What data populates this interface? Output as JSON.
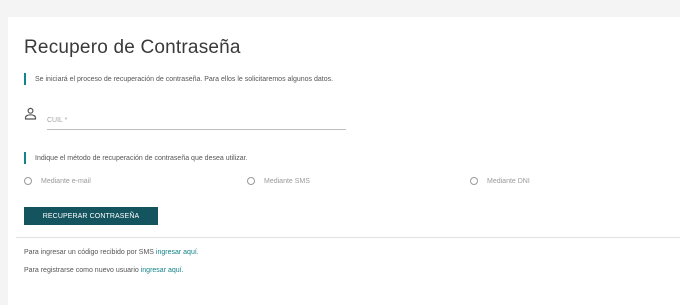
{
  "form": {
    "title": "Recupero de Contraseña",
    "intro": "Se iniciará el proceso de recuperación de contraseña. Para ellos le solicitaremos algunos datos.",
    "cuil_placeholder": "CUIL *",
    "cuil_value": "",
    "method_prompt": "Indique el método de recuperación de contraseña que desea utilizar.",
    "options": [
      {
        "label": "Mediante e-mail"
      },
      {
        "label": "Mediante SMS"
      },
      {
        "label": "Mediante DNI"
      }
    ],
    "submit_label": "RECUPERAR CONTRASEÑA"
  },
  "footer": {
    "sms_text": "Para ingresar un código recibido por SMS",
    "sms_link": "ingresar aquí.",
    "register_text": "Para registrarse como nuevo usuario",
    "register_link": "ingresar aquí."
  },
  "icons": {
    "user": "person-icon",
    "accent": "accent-bar"
  },
  "colors": {
    "accent": "#15838a",
    "button": "#13545f",
    "link": "#15838a"
  }
}
